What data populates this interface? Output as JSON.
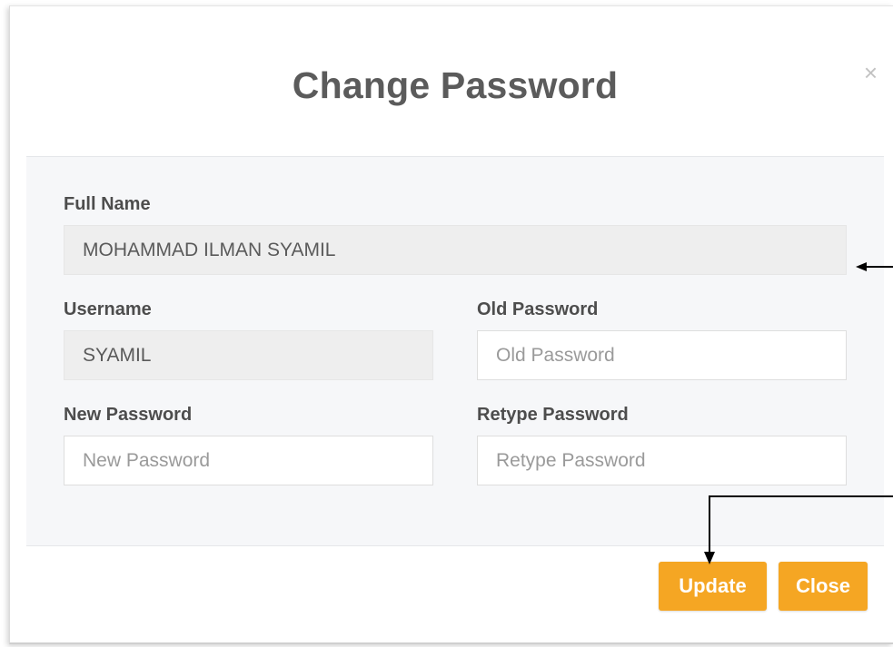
{
  "modal": {
    "title": "Change Password",
    "close_symbol": "×"
  },
  "form": {
    "full_name": {
      "label": "Full Name",
      "value": "MOHAMMAD ILMAN SYAMIL"
    },
    "username": {
      "label": "Username",
      "value": "SYAMIL"
    },
    "old_password": {
      "label": "Old Password",
      "placeholder": "Old Password",
      "value": ""
    },
    "new_password": {
      "label": "New Password",
      "placeholder": "New Password",
      "value": ""
    },
    "retype_password": {
      "label": "Retype Password",
      "placeholder": "Retype Password",
      "value": ""
    }
  },
  "footer": {
    "update_label": "Update",
    "close_label": "Close"
  },
  "colors": {
    "accent": "#f5a623",
    "title": "#5b5b5b",
    "body_bg": "#f6f7f9",
    "readonly_bg": "#eeeeee"
  },
  "icons": {
    "close": "close-icon",
    "annotation_arrows": "arrow-icon"
  }
}
